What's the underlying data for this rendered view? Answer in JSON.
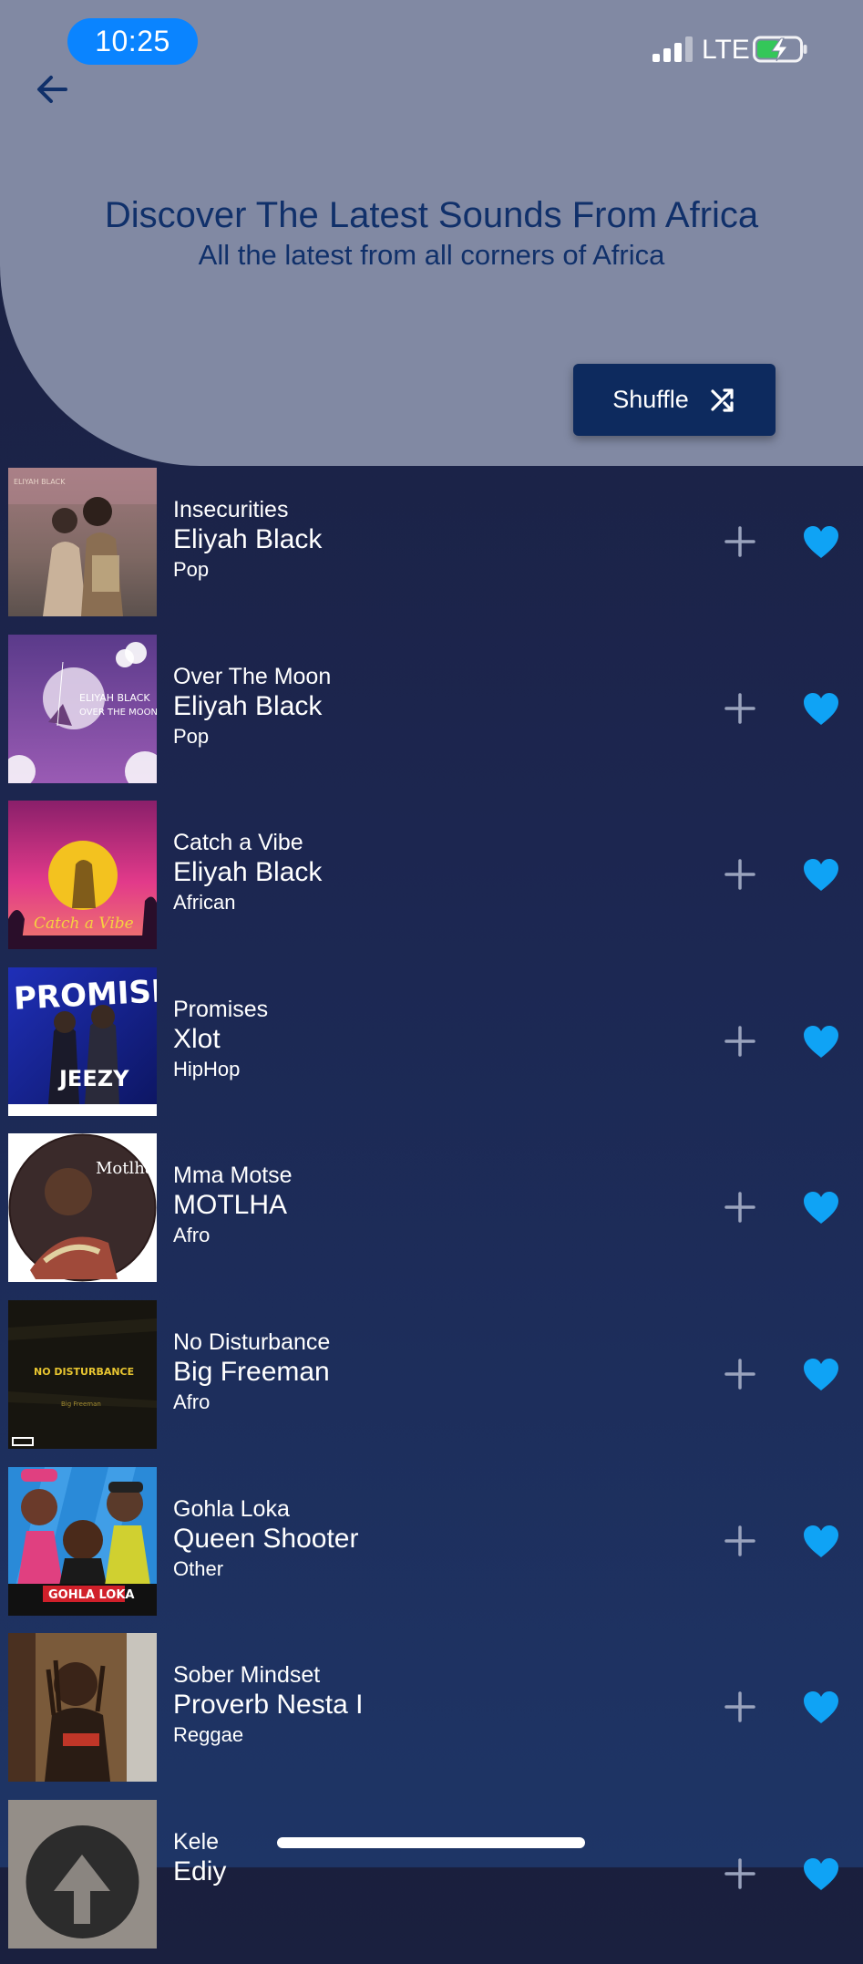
{
  "status_bar": {
    "time": "10:25",
    "network": "LTE"
  },
  "header": {
    "back_icon": "arrow-left-icon",
    "title": "Discover The Latest Sounds From Africa",
    "subtitle": "All the latest from all corners of Africa",
    "shuffle_label": "Shuffle",
    "shuffle_icon": "shuffle-icon"
  },
  "colors": {
    "header_bg": "#8189a3",
    "title_text": "#10306a",
    "shuffle_bg": "#0d2a5e",
    "heart": "#0fa3f5",
    "time_pill": "#0a84ff"
  },
  "tracks": [
    {
      "title": "Insecurities",
      "artist": "Eliyah Black",
      "genre": "Pop",
      "liked": true
    },
    {
      "title": "Over The Moon",
      "artist": "Eliyah Black",
      "genre": "Pop",
      "liked": true
    },
    {
      "title": "Catch a Vibe",
      "artist": "Eliyah Black",
      "genre": "African",
      "liked": true
    },
    {
      "title": "Promises",
      "artist": "Xlot",
      "genre": "HipHop",
      "liked": true
    },
    {
      "title": "Mma Motse",
      "artist": "MOTLHA",
      "genre": "Afro",
      "liked": true
    },
    {
      "title": "No Disturbance",
      "artist": "Big Freeman",
      "genre": "Afro",
      "liked": true
    },
    {
      "title": "Gohla Loka",
      "artist": "Queen Shooter",
      "genre": "Other",
      "liked": true
    },
    {
      "title": "Sober Mindset",
      "artist": "Proverb Nesta I",
      "genre": "Reggae",
      "liked": true
    },
    {
      "title": "Kele",
      "artist": "Ediy",
      "genre": "",
      "liked": true
    }
  ]
}
